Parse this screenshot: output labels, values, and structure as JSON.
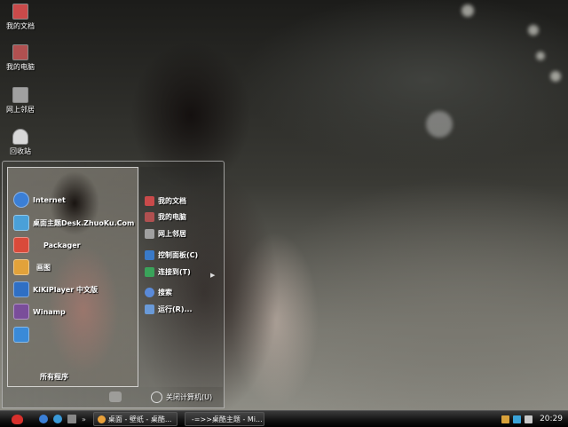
{
  "desktop": {
    "icons": [
      {
        "label": "我的文档",
        "icon": "my-documents-icon",
        "color": "#c94a4a"
      },
      {
        "label": "我的电脑",
        "icon": "my-computer-icon",
        "color": "#b05050"
      },
      {
        "label": "网上邻居",
        "icon": "network-places-icon",
        "color": "#a0a0a0"
      },
      {
        "label": "回收站",
        "icon": "recycle-bin-icon",
        "color": "#d8d8d8"
      }
    ]
  },
  "start_menu": {
    "programs": [
      {
        "label": "Internet",
        "icon": "internet-explorer-icon",
        "color": "#3b7fd6"
      },
      {
        "label": "桌面主题Desk.ZhuoKu.Com",
        "icon": "theme-icon",
        "color": "#4aa0d8"
      },
      {
        "label": "Packager",
        "icon": "packager-icon",
        "color": "#d94a3a"
      },
      {
        "label": "画图",
        "icon": "paint-icon",
        "color": "#e2a23a"
      },
      {
        "label": "KiKiPlayer 中文版",
        "icon": "player-icon",
        "color": "#2f6fc4"
      },
      {
        "label": "Winamp",
        "icon": "winamp-icon",
        "color": "#7a4d9a"
      },
      {
        "label": "",
        "icon": "app-icon",
        "color": "#3a8ad8"
      }
    ],
    "all_programs_label": "所有程序",
    "places": [
      {
        "label": "我的文档",
        "icon": "my-documents-icon",
        "color": "#c94a4a"
      },
      {
        "label": "我的电脑",
        "icon": "my-computer-icon",
        "color": "#b05050"
      },
      {
        "label": "网上邻居",
        "icon": "network-places-icon",
        "color": "#a0a0a0"
      },
      {
        "label": "控制面板(C)",
        "icon": "control-panel-icon",
        "color": "#3a7ac8"
      },
      {
        "label": "连接到(T)",
        "icon": "connect-to-icon",
        "color": "#3aa35a"
      },
      {
        "label": "搜索",
        "icon": "search-icon",
        "color": "#5a8ad8"
      },
      {
        "label": "运行(R)...",
        "icon": "run-icon",
        "color": "#6a9ad8"
      }
    ],
    "shutdown_label": "关闭计算机(U)"
  },
  "taskbar": {
    "tasks": [
      {
        "label": "桌面 - 壁纸 - 桌酷...",
        "icon": "browser-icon",
        "color": "#e9a13a"
      },
      {
        "label": "-=>>桌酷主题 - Mi...",
        "icon": "document-icon",
        "color": "#3a7ac8"
      }
    ],
    "quick_launch": [
      {
        "icon": "ie-icon",
        "color": "#3b7fd6"
      },
      {
        "icon": "media-icon",
        "color": "#3a9ad8"
      },
      {
        "icon": "show-desktop-icon",
        "color": "#888888"
      }
    ],
    "tray": [
      {
        "icon": "tray-network-icon",
        "color": "#d8a13a"
      },
      {
        "icon": "tray-display-icon",
        "color": "#3aa3d8"
      },
      {
        "icon": "tray-volume-icon",
        "color": "#c8c8c8"
      }
    ],
    "clock": "20:29"
  }
}
